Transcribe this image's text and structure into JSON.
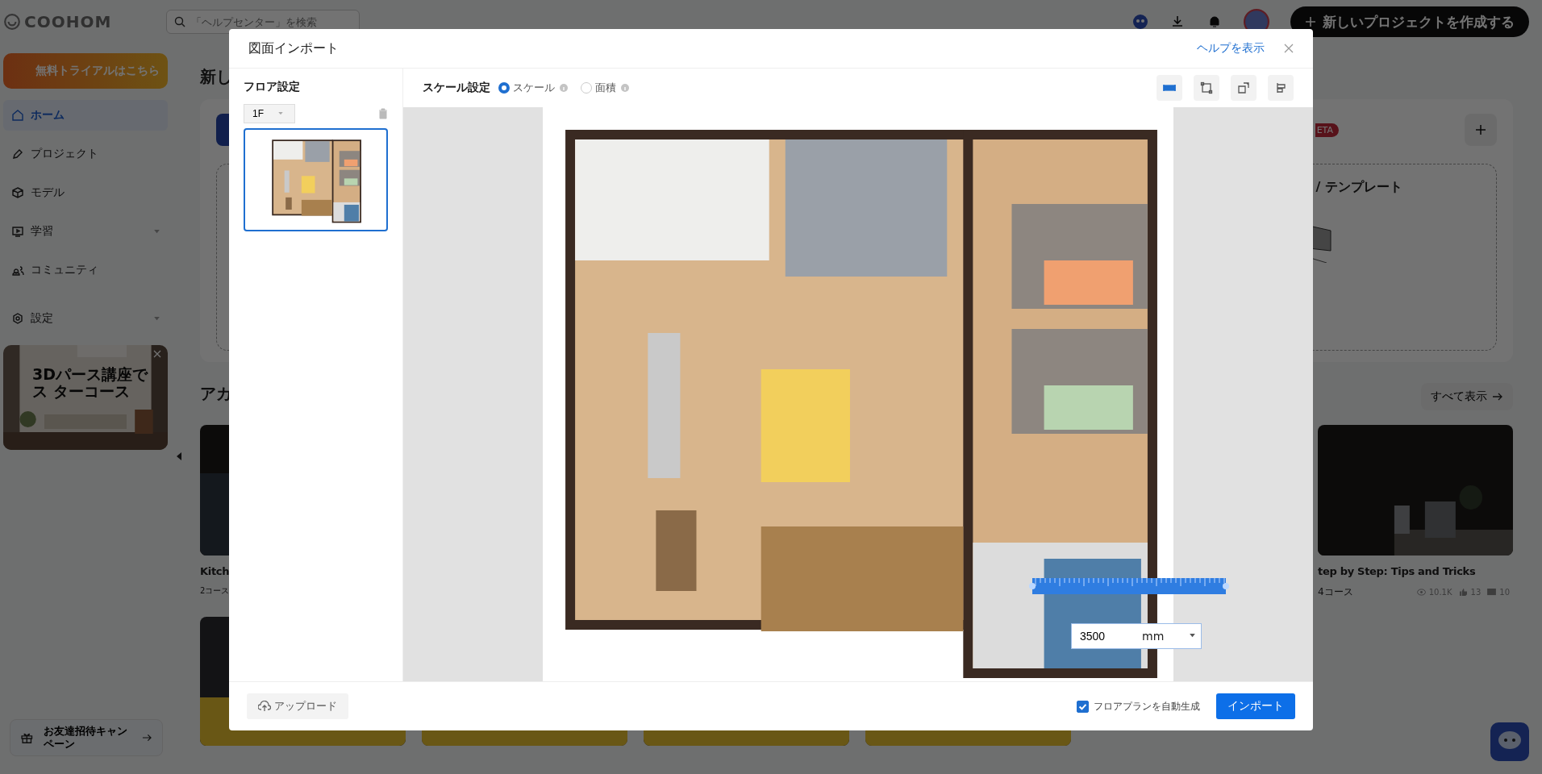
{
  "app": {
    "logo": "COOHOM",
    "search": {
      "placeholder": "「ヘルプセンター」を検索"
    },
    "trial_button": "無料トライアルはこちら",
    "nav": [
      {
        "label": "ホーム",
        "selected": true,
        "expandable": false
      },
      {
        "label": "プロジェクト",
        "selected": false,
        "expandable": false
      },
      {
        "label": "モデル",
        "selected": false,
        "expandable": false
      },
      {
        "label": "学習",
        "selected": false,
        "expandable": true
      },
      {
        "label": "コミュニティ",
        "selected": false,
        "expandable": false
      },
      {
        "label": "設定",
        "selected": false,
        "expandable": true
      }
    ],
    "promo": {
      "title_lines": [
        "3Dパース講座で",
        "ス ターコース"
      ]
    },
    "invite_button": "お友達招待キャンペーン",
    "create_button": "新しいプロジェクトを作成する",
    "main": {
      "heading_1": "新し",
      "beta_badge": "ETA",
      "template_card": "/ テンプレート",
      "heading_2": "アカ",
      "view_all": "すべて表示",
      "courses": [
        {
          "title": "Kitch",
          "count": "2コース"
        },
        {
          "title": "tep by Step: Tips and Tricks",
          "count": "4コース",
          "views": "10.1K",
          "likes": "13",
          "comments": "10"
        }
      ]
    }
  },
  "dialog": {
    "title": "図面インポート",
    "help_link": "ヘルプを表示",
    "floor_panel": {
      "heading": "フロア設定",
      "floor_select": "1F",
      "thumbnails": [
        {
          "selected": true
        }
      ]
    },
    "scale": {
      "label": "スケール設定",
      "options": [
        {
          "label": "スケール",
          "selected": true
        },
        {
          "label": "面積",
          "selected": false
        }
      ]
    },
    "tools": [
      {
        "selected": true
      },
      {
        "selected": false
      },
      {
        "selected": false
      },
      {
        "selected": false
      }
    ],
    "measure": {
      "value": "3500",
      "unit": "mm"
    },
    "upload_button": "アップロード",
    "auto_generate": {
      "label": "フロアプランを自動生成",
      "checked": true
    },
    "import_button": "インポート"
  }
}
